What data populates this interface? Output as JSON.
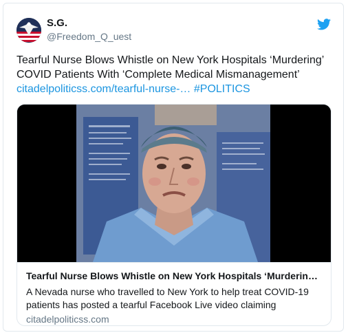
{
  "user": {
    "display_name": "S.G.",
    "handle": "@Freedom_Q_uest"
  },
  "icons": {
    "brand": "twitter-bird-icon",
    "avatar": "eagle-flag-avatar"
  },
  "colors": {
    "link": "#1b95e0",
    "brand": "#1da1f2",
    "secondary_text": "#657786",
    "border": "#e1e8ed"
  },
  "tweet": {
    "text_line1": "Tearful Nurse Blows Whistle on New York Hospitals ‘Murdering’",
    "text_line2": "COVID Patients With ‘Complete Medical Mismanagement’",
    "link_text": "citadelpoliticss.com/tearful-nurse-…",
    "hashtag": "#POLITICS"
  },
  "card": {
    "title": "Tearful Nurse Blows Whistle on New York Hospitals ‘Murderin…",
    "description_line1": "A Nevada nurse who travelled to New York to help treat COVID-19",
    "description_line2": "patients has posted a tearful Facebook Live video claiming",
    "domain": "citadelpoliticss.com"
  }
}
